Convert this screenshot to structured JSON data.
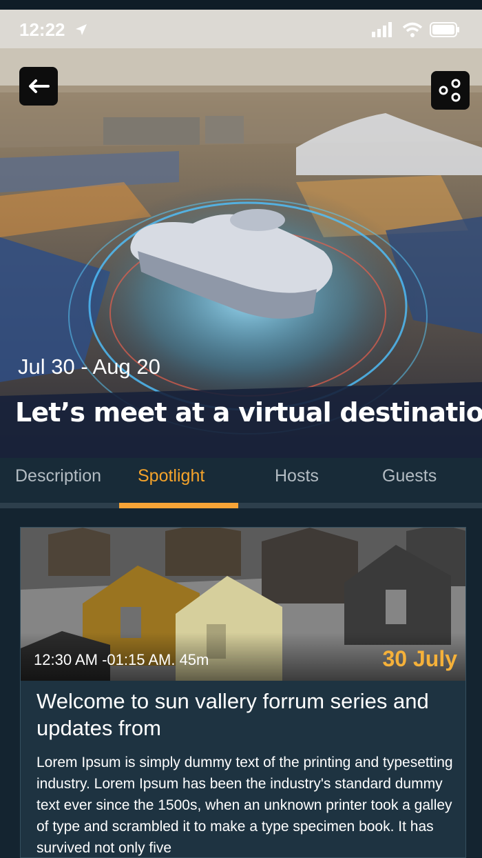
{
  "status_bar": {
    "time": "12:22"
  },
  "hero": {
    "date_range": "Jul 30 - Aug 20",
    "title": "Let’s meet at a virtual destination"
  },
  "icons": {
    "back": "back-arrow-icon",
    "share": "share-nodes-icon"
  },
  "tabs": [
    {
      "label": "Description",
      "active": false
    },
    {
      "label": "Spotlight",
      "active": true
    },
    {
      "label": "Hosts",
      "active": false
    },
    {
      "label": "Guests",
      "active": false
    }
  ],
  "card": {
    "time_range": "12:30 AM -01:15 AM. 45m",
    "date": "30 July",
    "title": "Welcome to sun vallery forrum series and updates from",
    "body": "Lorem Ipsum is simply dummy text of the printing and typesetting industry. Lorem Ipsum has been the industry's standard dummy text ever since the 1500s, when an unknown printer took a galley of type and scrambled it to make a type specimen book. It has survived not only five"
  },
  "colors": {
    "accent": "#f7a437",
    "background": "#13212c",
    "card": "#1e3341"
  }
}
